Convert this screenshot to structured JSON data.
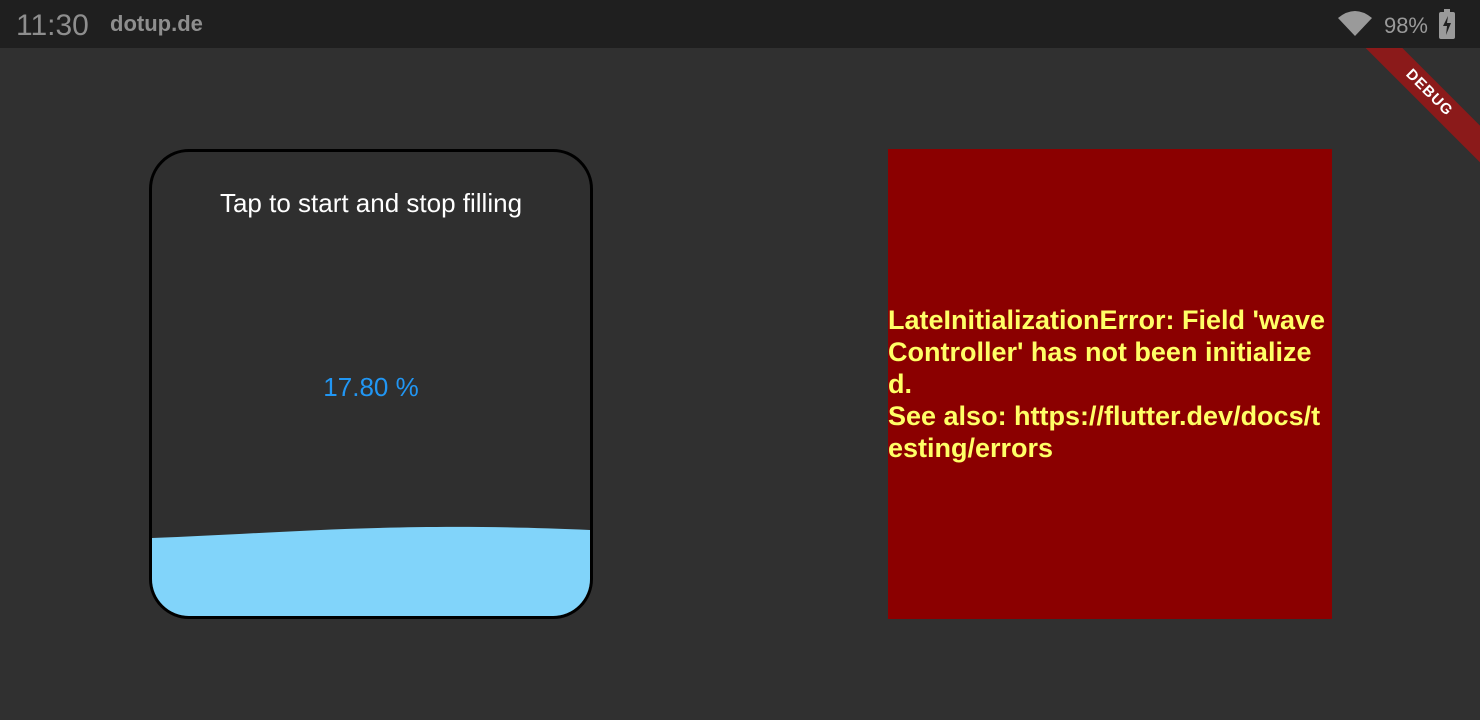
{
  "status_bar": {
    "time": "11:30",
    "site": "dotup.de",
    "battery_percent": "98%",
    "icons": [
      "wifi-icon",
      "battery-charging-icon"
    ]
  },
  "debug_banner": {
    "label": "DEBUG",
    "color": "#8b1a1a"
  },
  "tank": {
    "instruction": "Tap to start and stop filling",
    "percent_text": "17.80 %",
    "fill_level": 0.178,
    "water_color": "#81d4fa",
    "percent_color": "#2196f3"
  },
  "error": {
    "message": "LateInitializationError: Field 'waveController' has not been initialized.\nSee also: https://flutter.dev/docs/testing/errors",
    "background": "#8b0000",
    "text_color": "#ffff66"
  }
}
